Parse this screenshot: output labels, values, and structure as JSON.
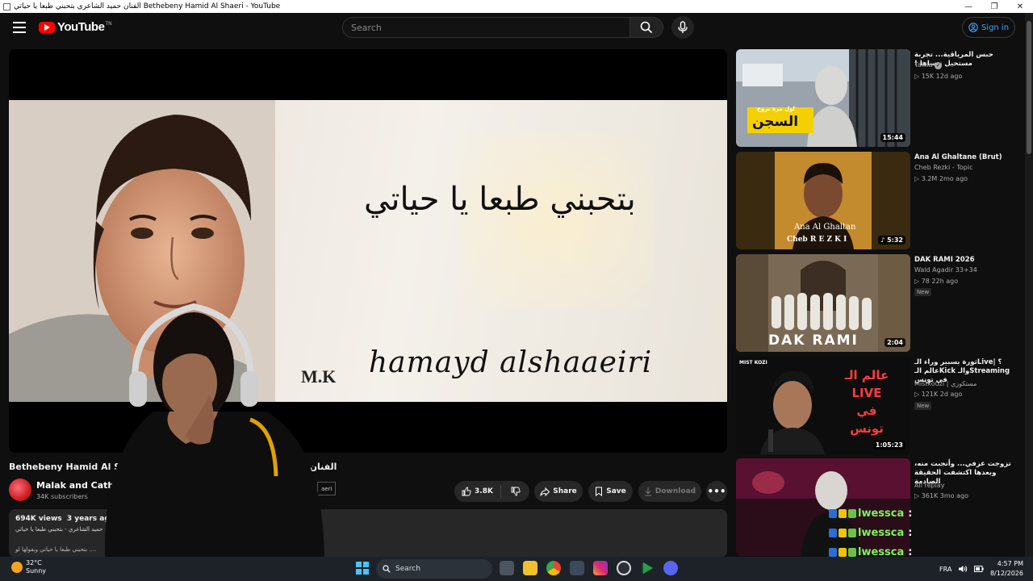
{
  "window": {
    "title": "الفنان حميد الشاعري بتحبني طبعا يا حياتي Bethebeny Hamid Al Shaeri - YouTube",
    "minimize": "—",
    "maximize": "❐",
    "close": "✕"
  },
  "header": {
    "logo_text": "YouTube",
    "logo_tm": "TN",
    "search_placeholder": "Search",
    "signin_label": "Sign in"
  },
  "video": {
    "caption_arabic": "بتحبني طبعا يا حياتي",
    "caption_mk": "M.K",
    "caption_name": "hamayd alshaaeiri",
    "title": "الفنان حميد الشاعري بتحبني طبعا يا حياتي Bethebeny Hamid Al Shaeri",
    "channel_name": "Malak and Catheri",
    "subscribers": "34K subscribers",
    "subscribe_fragment": "aeri",
    "likes": "3.8K",
    "share_label": "Share",
    "save_label": "Save",
    "download_label": "Download",
    "more_label": "•••",
    "views": "694K views",
    "age": "3 years ago",
    "description_line1": "حميد الشاعري - بتحبني طبعا يا حياتي",
    "description_line2": "بتحبني طبعا يا حياتي وبقولها لو ...."
  },
  "recommendations": [
    {
      "title": "حبس المرياقية... تجربة مستحيل ننساها !",
      "channel": "Takila",
      "verified": true,
      "meta": "▷ 15K   12d ago",
      "duration": "15:44",
      "badge": "",
      "thumb_text": "السجن",
      "thumb_subtext": "اول مرة نروح"
    },
    {
      "title": "Ana Al Ghaltane (Brut)",
      "channel": "Cheb Rezki - Topic",
      "verified": false,
      "meta": "▷ 3.2M   2mo ago",
      "duration": "♪ 5:32",
      "badge": "",
      "thumb_text": "Ana Al Ghaltan",
      "thumb_subtext": "Cheb R E Z K I"
    },
    {
      "title": "DAK RAMI 2026",
      "channel": "Wald Agadir 33+34",
      "verified": false,
      "meta": "▷ 78   22h ago",
      "duration": "2:04",
      "badge": "New",
      "thumb_text": "DAK RAMI",
      "thumb_subtext": ""
    },
    {
      "title": "ثورة بسبير وراء الـLive؟ | عالم الـKick والـStreaming في تونس",
      "channel": "Mistkouzi | مستكوزي",
      "verified": false,
      "meta": "▷ 121K   2d ago",
      "duration": "1:05:23",
      "badge": "New",
      "thumb_text": "عالم الـ LIVE في تونس",
      "thumb_subtext": "MIST KOZI"
    },
    {
      "title": "تزوجت عرفي... وأنجبت منه، وبعدها اكتشفت الحقيقة الصادمة",
      "channel": "All replay",
      "verified": false,
      "meta": "▷ 361K   3mo ago",
      "duration": "",
      "badge": "",
      "thumb_text": "",
      "thumb_subtext": ""
    }
  ],
  "chat": [
    {
      "name": "lwessca",
      "sep": ":"
    },
    {
      "name": "lwessca",
      "sep": ":"
    },
    {
      "name": "lwessca",
      "sep": ":"
    },
    {
      "name": "lwessca",
      "sep": ":"
    }
  ],
  "taskbar": {
    "temperature": "32°C",
    "weather": "Sunny",
    "search_label": "Search",
    "language": "FRA",
    "time": "4:57 PM",
    "date": "8/12/2026"
  },
  "colors": {
    "brand_red": "#ff0000",
    "link_blue": "#3ea6ff",
    "chat_green": "#7cf65a"
  }
}
